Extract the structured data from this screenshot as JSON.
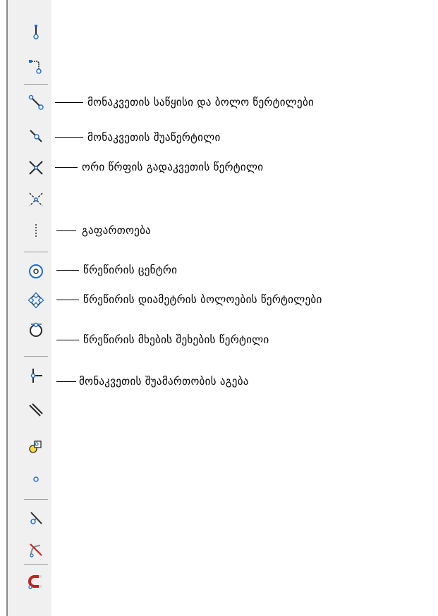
{
  "toolbar": {
    "tools": [
      {
        "id": "vertical-endpoint-snap",
        "icon": "vertical-segment-icon"
      },
      {
        "id": "polyline-endpoint-snap",
        "icon": "polyline-icon"
      },
      {
        "id": "segment-endpoints-snap",
        "icon": "segment-endpoints-icon"
      },
      {
        "id": "segment-midpoint-snap",
        "icon": "segment-midpoint-icon"
      },
      {
        "id": "line-intersection-snap",
        "icon": "intersection-icon"
      },
      {
        "id": "apparent-intersection-snap",
        "icon": "apparent-intersection-icon"
      },
      {
        "id": "extension-snap",
        "icon": "extension-icon"
      },
      {
        "id": "circle-center-snap",
        "icon": "circle-center-icon"
      },
      {
        "id": "circle-quadrant-snap",
        "icon": "circle-quadrant-icon"
      },
      {
        "id": "circle-tangent-snap",
        "icon": "circle-tangent-icon"
      },
      {
        "id": "perpendicular-snap",
        "icon": "perpendicular-icon"
      },
      {
        "id": "parallel-snap",
        "icon": "parallel-icon"
      },
      {
        "id": "insertion-snap",
        "icon": "insertion-icon"
      },
      {
        "id": "node-snap",
        "icon": "node-icon"
      },
      {
        "id": "nearest-snap",
        "icon": "nearest-icon"
      },
      {
        "id": "snap-none",
        "icon": "snap-none-icon"
      },
      {
        "id": "magnet-settings",
        "icon": "magnet-icon"
      }
    ]
  },
  "labels": {
    "segment_endpoints": "მონაკვეთის საწყისი და ბოლო წერტილები",
    "segment_midpoint": "მონაკვეთის შუაწერტილი",
    "line_intersection": "ორი წრფის გადაკვეთის წერტილი",
    "extension": "გაფართოება",
    "circle_center": "წრეწირის ცენტრი",
    "circle_quadrants": "წრეწირის დიამეტრის ბოლოების წერტილები",
    "circle_tangent": "წრეწირის მხების შეხების წერტილი",
    "perpendicular": "მონაკვეთის შუამართობის აგება"
  },
  "colors": {
    "node_fill": "#ffffff",
    "node_stroke": "#1e6fc8",
    "line": "#2a2a2a",
    "accent_red": "#c81e1e"
  }
}
